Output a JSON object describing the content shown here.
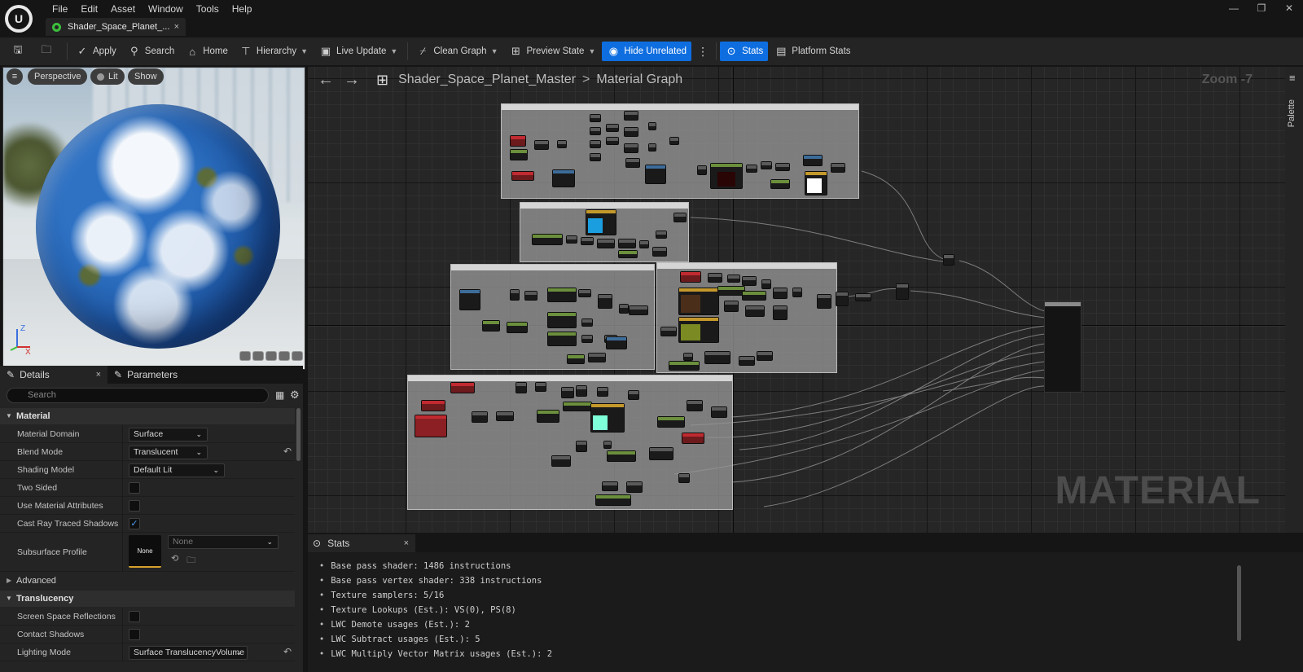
{
  "menu": {
    "items": [
      "File",
      "Edit",
      "Asset",
      "Window",
      "Tools",
      "Help"
    ]
  },
  "document_tab": {
    "label": "Shader_Space_Planet_...",
    "close": "×"
  },
  "window_controls": {
    "minimize": "—",
    "maximize": "❐",
    "close": "✕"
  },
  "toolbar": {
    "apply": "Apply",
    "search": "Search",
    "home": "Home",
    "hierarchy": "Hierarchy",
    "live_update": "Live Update",
    "clean_graph": "Clean Graph",
    "preview_state": "Preview State",
    "hide_unrelated": "Hide Unrelated",
    "stats": "Stats",
    "platform_stats": "Platform Stats",
    "accent_color": "#0e6ee0"
  },
  "viewport": {
    "perspective": "Perspective",
    "lit": "Lit",
    "show": "Show",
    "axis_z": "Z",
    "axis_x": "X"
  },
  "details": {
    "tab_details": "Details",
    "tab_parameters": "Parameters",
    "search_placeholder": "Search",
    "categories": {
      "material": "Material",
      "advanced": "Advanced",
      "translucency": "Translucency"
    },
    "properties": {
      "material_domain": {
        "label": "Material Domain",
        "value": "Surface"
      },
      "blend_mode": {
        "label": "Blend Mode",
        "value": "Translucent"
      },
      "shading_model": {
        "label": "Shading Model",
        "value": "Default Lit"
      },
      "two_sided": {
        "label": "Two Sided",
        "checked": false
      },
      "use_material_attributes": {
        "label": "Use Material Attributes",
        "checked": false
      },
      "cast_ray_traced_shadows": {
        "label": "Cast Ray Traced Shadows",
        "checked": true,
        "check_glyph": "✓"
      },
      "subsurface_profile": {
        "label": "Subsurface Profile",
        "thumb": "None",
        "value": "None"
      },
      "screen_space_reflections": {
        "label": "Screen Space Reflections",
        "checked": false
      },
      "contact_shadows": {
        "label": "Contact Shadows",
        "checked": false
      },
      "lighting_mode": {
        "label": "Lighting Mode",
        "value": "Surface TranslucencyVolume"
      }
    }
  },
  "graph": {
    "breadcrumb_asset": "Shader_Space_Planet_Master",
    "breadcrumb_sep": ">",
    "breadcrumb_graph": "Material Graph",
    "zoom": "Zoom -7",
    "watermark": "MATERIAL",
    "palette_label": "Palette"
  },
  "stats": {
    "tab_label": "Stats",
    "close": "×",
    "lines": [
      "Base pass shader: 1486 instructions",
      "Base pass vertex shader: 338 instructions",
      "Texture samplers: 5/16",
      "Texture Lookups (Est.): VS(0), PS(8)",
      "LWC Demote usages (Est.): 2",
      "LWC Subtract usages (Est.): 5",
      "LWC Multiply Vector Matrix usages (Est.): 2"
    ]
  }
}
